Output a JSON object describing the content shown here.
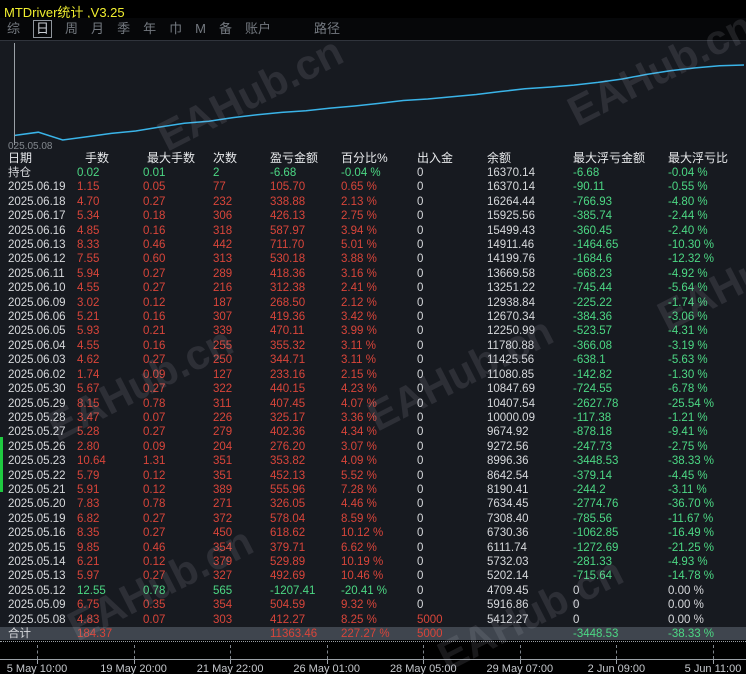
{
  "window": {
    "title": "MTDriver统计 ,V3.25"
  },
  "menu": {
    "items": [
      "综",
      "日",
      "周",
      "月",
      "季",
      "年",
      "巾",
      "M",
      "备",
      "账户"
    ],
    "active": "日",
    "path_item": "路径"
  },
  "watermark": "EAHub.cn",
  "colors": {
    "profit_red": "#d9453a",
    "loss_green": "#4cd884",
    "text_white": "#d7d9dc",
    "title_yellow": "#f0ee30",
    "chart_line": "#3ab4e8",
    "background": "#171a20"
  },
  "chart_data": {
    "type": "line",
    "series_name": "余额",
    "start_label": "025.05.08",
    "line_color": "#3ab4e8",
    "dates": [
      "2025.05.08",
      "2025.05.09",
      "2025.05.12",
      "2025.05.13",
      "2025.05.14",
      "2025.05.15",
      "2025.05.16",
      "2025.05.19",
      "2025.05.20",
      "2025.05.21",
      "2025.05.22",
      "2025.05.23",
      "2025.05.26",
      "2025.05.27",
      "2025.05.28",
      "2025.05.29",
      "2025.05.30",
      "2025.06.02",
      "2025.06.03",
      "2025.06.04",
      "2025.06.05",
      "2025.06.06",
      "2025.06.09",
      "2025.06.10",
      "2025.06.11",
      "2025.06.12",
      "2025.06.13",
      "2025.06.16",
      "2025.06.17",
      "2025.06.18",
      "2025.06.19"
    ],
    "balances": [
      5412.27,
      5916.86,
      4709.45,
      5202.14,
      5732.03,
      6111.74,
      6730.36,
      7308.4,
      7634.45,
      8190.41,
      8642.54,
      8996.36,
      9272.56,
      9674.92,
      10000.09,
      10407.54,
      10847.69,
      11080.85,
      11425.56,
      11780.88,
      12250.99,
      12670.34,
      12938.84,
      13251.22,
      13669.58,
      14199.76,
      14911.46,
      15499.43,
      15925.56,
      16264.44,
      16370.14
    ],
    "x_axis_labels": [
      "5 May 10:00",
      "19 May 20:00",
      "21 May 22:00",
      "26 May 01:00",
      "28 May 05:00",
      "29 May 07:00",
      "2 Jun 09:00",
      "5 Jun 11:00"
    ],
    "ylim": [
      4709.45,
      16370.14
    ],
    "grid": false,
    "legend": "none"
  },
  "table": {
    "headers": [
      "日期",
      "手数",
      "最大手数",
      "次数",
      "盈亏金额",
      "百分比%",
      "出入金",
      "余额",
      "最大浮亏金额",
      "最大浮亏比"
    ],
    "rows": [
      {
        "tone": "green",
        "cells": [
          "持仓",
          "0.02",
          "0.01",
          "2",
          "-6.68",
          "-0.04 %",
          "0",
          "16370.14",
          "-6.68",
          "-0.04 %"
        ]
      },
      {
        "tone": "red",
        "cells": [
          "2025.06.19",
          "1.15",
          "0.05",
          "77",
          "105.70",
          "0.65 %",
          "0",
          "16370.14",
          "-90.11",
          "-0.55 %"
        ]
      },
      {
        "tone": "red",
        "cells": [
          "2025.06.18",
          "4.70",
          "0.27",
          "232",
          "338.88",
          "2.13 %",
          "0",
          "16264.44",
          "-766.93",
          "-4.80 %"
        ]
      },
      {
        "tone": "red",
        "cells": [
          "2025.06.17",
          "5.34",
          "0.18",
          "306",
          "426.13",
          "2.75 %",
          "0",
          "15925.56",
          "-385.74",
          "-2.44 %"
        ]
      },
      {
        "tone": "red",
        "cells": [
          "2025.06.16",
          "4.85",
          "0.16",
          "318",
          "587.97",
          "3.94 %",
          "0",
          "15499.43",
          "-360.45",
          "-2.40 %"
        ]
      },
      {
        "tone": "red",
        "cells": [
          "2025.06.13",
          "8.33",
          "0.46",
          "442",
          "711.70",
          "5.01 %",
          "0",
          "14911.46",
          "-1464.65",
          "-10.30 %"
        ]
      },
      {
        "tone": "red",
        "cells": [
          "2025.06.12",
          "7.55",
          "0.60",
          "313",
          "530.18",
          "3.88 %",
          "0",
          "14199.76",
          "-1684.6",
          "-12.32 %"
        ]
      },
      {
        "tone": "red",
        "cells": [
          "2025.06.11",
          "5.94",
          "0.27",
          "289",
          "418.36",
          "3.16 %",
          "0",
          "13669.58",
          "-668.23",
          "-4.92 %"
        ]
      },
      {
        "tone": "red",
        "cells": [
          "2025.06.10",
          "4.55",
          "0.27",
          "216",
          "312.38",
          "2.41 %",
          "0",
          "13251.22",
          "-745.44",
          "-5.64 %"
        ]
      },
      {
        "tone": "red",
        "cells": [
          "2025.06.09",
          "3.02",
          "0.12",
          "187",
          "268.50",
          "2.12 %",
          "0",
          "12938.84",
          "-225.22",
          "-1.74 %"
        ]
      },
      {
        "tone": "red",
        "cells": [
          "2025.06.06",
          "5.21",
          "0.16",
          "307",
          "419.36",
          "3.42 %",
          "0",
          "12670.34",
          "-384.36",
          "-3.06 %"
        ]
      },
      {
        "tone": "red",
        "cells": [
          "2025.06.05",
          "5.93",
          "0.21",
          "339",
          "470.11",
          "3.99 %",
          "0",
          "12250.99",
          "-523.57",
          "-4.31 %"
        ]
      },
      {
        "tone": "red",
        "cells": [
          "2025.06.04",
          "4.55",
          "0.16",
          "255",
          "355.32",
          "3.11 %",
          "0",
          "11780.88",
          "-366.08",
          "-3.19 %"
        ]
      },
      {
        "tone": "red",
        "cells": [
          "2025.06.03",
          "4.62",
          "0.27",
          "250",
          "344.71",
          "3.11 %",
          "0",
          "11425.56",
          "-638.1",
          "-5.63 %"
        ]
      },
      {
        "tone": "red",
        "cells": [
          "2025.06.02",
          "1.74",
          "0.09",
          "127",
          "233.16",
          "2.15 %",
          "0",
          "11080.85",
          "-142.82",
          "-1.30 %"
        ]
      },
      {
        "tone": "red",
        "cells": [
          "2025.05.30",
          "5.67",
          "0.27",
          "322",
          "440.15",
          "4.23 %",
          "0",
          "10847.69",
          "-724.55",
          "-6.78 %"
        ]
      },
      {
        "tone": "red",
        "cells": [
          "2025.05.29",
          "8.15",
          "0.78",
          "311",
          "407.45",
          "4.07 %",
          "0",
          "10407.54",
          "-2627.78",
          "-25.54 %"
        ]
      },
      {
        "tone": "red",
        "cells": [
          "2025.05.28",
          "3.47",
          "0.07",
          "226",
          "325.17",
          "3.36 %",
          "0",
          "10000.09",
          "-117.38",
          "-1.21 %"
        ]
      },
      {
        "tone": "red",
        "cells": [
          "2025.05.27",
          "5.28",
          "0.27",
          "279",
          "402.36",
          "4.34 %",
          "0",
          "9674.92",
          "-878.18",
          "-9.41 %"
        ]
      },
      {
        "tone": "red",
        "cells": [
          "2025.05.26",
          "2.80",
          "0.09",
          "204",
          "276.20",
          "3.07 %",
          "0",
          "9272.56",
          "-247.73",
          "-2.75 %"
        ]
      },
      {
        "tone": "red",
        "cells": [
          "2025.05.23",
          "10.64",
          "1.31",
          "351",
          "353.82",
          "4.09 %",
          "0",
          "8996.36",
          "-3448.53",
          "-38.33 %"
        ]
      },
      {
        "tone": "red",
        "cells": [
          "2025.05.22",
          "5.79",
          "0.12",
          "351",
          "452.13",
          "5.52 %",
          "0",
          "8642.54",
          "-379.14",
          "-4.45 %"
        ]
      },
      {
        "tone": "red",
        "cells": [
          "2025.05.21",
          "5.91",
          "0.12",
          "389",
          "555.96",
          "7.28 %",
          "0",
          "8190.41",
          "-244.2",
          "-3.11 %"
        ]
      },
      {
        "tone": "red",
        "cells": [
          "2025.05.20",
          "7.83",
          "0.78",
          "271",
          "326.05",
          "4.46 %",
          "0",
          "7634.45",
          "-2774.76",
          "-36.70 %"
        ]
      },
      {
        "tone": "red",
        "cells": [
          "2025.05.19",
          "6.82",
          "0.27",
          "372",
          "578.04",
          "8.59 %",
          "0",
          "7308.40",
          "-785.56",
          "-11.67 %"
        ]
      },
      {
        "tone": "red",
        "cells": [
          "2025.05.16",
          "8.35",
          "0.27",
          "450",
          "618.62",
          "10.12 %",
          "0",
          "6730.36",
          "-1062.85",
          "-16.49 %"
        ]
      },
      {
        "tone": "red",
        "cells": [
          "2025.05.15",
          "9.85",
          "0.46",
          "354",
          "379.71",
          "6.62 %",
          "0",
          "6111.74",
          "-1272.69",
          "-21.25 %"
        ]
      },
      {
        "tone": "red",
        "cells": [
          "2025.05.14",
          "6.21",
          "0.12",
          "379",
          "529.89",
          "10.19 %",
          "0",
          "5732.03",
          "-281.33",
          "-4.93 %"
        ]
      },
      {
        "tone": "red",
        "cells": [
          "2025.05.13",
          "5.97",
          "0.27",
          "327",
          "492.69",
          "10.46 %",
          "0",
          "5202.14",
          "-715.64",
          "-14.78 %"
        ]
      },
      {
        "tone": "green",
        "cells": [
          "2025.05.12",
          "12.55",
          "0.78",
          "565",
          "-1207.41",
          "-20.41 %",
          "0",
          "4709.45",
          "0",
          "0.00 %"
        ]
      },
      {
        "tone": "red",
        "cells": [
          "2025.05.09",
          "6.75",
          "0.35",
          "354",
          "504.59",
          "9.32 %",
          "0",
          "5916.86",
          "0",
          "0.00 %"
        ]
      },
      {
        "tone": "red",
        "cells": [
          "2025.05.08",
          "4.83",
          "0.07",
          "303",
          "412.27",
          "8.25 %",
          "5000",
          "5412.27",
          "0",
          "0.00 %"
        ]
      },
      {
        "tone": "red",
        "total": true,
        "cells": [
          "合计",
          "184.37",
          "",
          "",
          "11363.46",
          "227.27 %",
          "5000",
          "",
          "-3448.53",
          "-38.33 %"
        ]
      }
    ]
  }
}
